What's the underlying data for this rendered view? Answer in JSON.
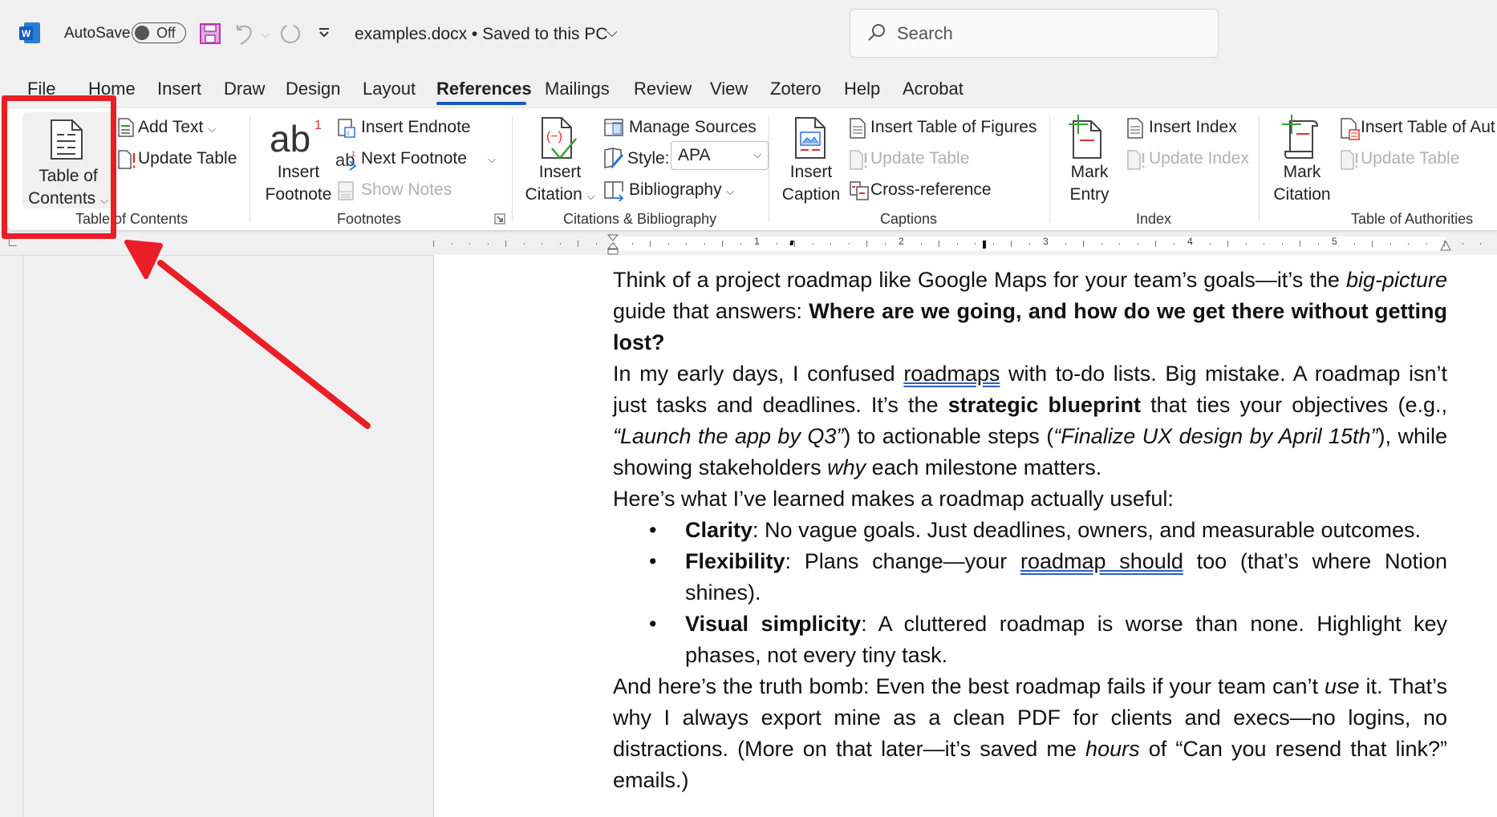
{
  "titlebar": {
    "app_icon": "word-icon",
    "autosave_label": "AutoSave",
    "autosave_state": "Off",
    "save_icon": "save-icon",
    "undo_icon": "undo-icon",
    "redo_icon": "redo-icon",
    "customize_icon": "customize-quick-access-icon",
    "document_title": "examples.docx • Saved to this PC",
    "search_placeholder": "Search"
  },
  "tabs": [
    {
      "label": "File"
    },
    {
      "label": "Home"
    },
    {
      "label": "Insert"
    },
    {
      "label": "Draw"
    },
    {
      "label": "Design"
    },
    {
      "label": "Layout"
    },
    {
      "label": "References",
      "active": true
    },
    {
      "label": "Mailings"
    },
    {
      "label": "Review"
    },
    {
      "label": "View"
    },
    {
      "label": "Zotero"
    },
    {
      "label": "Help"
    },
    {
      "label": "Acrobat"
    }
  ],
  "ribbon": {
    "toc": {
      "big_button": [
        "Table of",
        "Contents"
      ],
      "add_text": "Add Text",
      "update_table": "Update Table",
      "group_label": "Table of Contents"
    },
    "footnotes": {
      "big_button": [
        "Insert",
        "Footnote"
      ],
      "insert_endnote": "Insert Endnote",
      "next_footnote": "Next Footnote",
      "show_notes": "Show Notes",
      "group_label": "Footnotes"
    },
    "citations": {
      "big_button": [
        "Insert",
        "Citation"
      ],
      "manage_sources": "Manage Sources",
      "style_label": "Style:",
      "style_value": "APA",
      "bibliography": "Bibliography",
      "group_label": "Citations & Bibliography"
    },
    "captions": {
      "big_button": [
        "Insert",
        "Caption"
      ],
      "insert_table_of_figures": "Insert Table of Figures",
      "update_table": "Update Table",
      "cross_reference": "Cross-reference",
      "group_label": "Captions"
    },
    "index": {
      "big_button": [
        "Mark",
        "Entry"
      ],
      "insert_index": "Insert Index",
      "update_index": "Update Index",
      "group_label": "Index"
    },
    "authorities": {
      "big_button": [
        "Mark",
        "Citation"
      ],
      "insert_table": "Insert Table of Aut",
      "update_table": "Update Table",
      "group_label": "Table of Authorities"
    }
  },
  "ruler": {
    "numbers": [
      "1",
      "2",
      "3",
      "4",
      "5"
    ]
  },
  "document": {
    "p1": {
      "a": "Think of a project roadmap like Google Maps for your team’s goals—it’s the ",
      "b_italic": "big-picture",
      "c": " guide that answers: ",
      "d_bold": "Where are we going, and how do we get there without getting lost?"
    },
    "p2": {
      "a": "In my early days, I confused ",
      "b_underlined": "roadmaps",
      "c": " with to-do lists. Big mistake. A roadmap isn’t just tasks and deadlines. It’s the ",
      "d_bold": "strategic blueprint",
      "e": " that ties your objectives (e.g., ",
      "f_italic": "“Launch the app by Q3”",
      "g": ") to actionable steps (",
      "h_italic": "“Finalize UX design by April 15th”",
      "i": "), while showing stakeholders ",
      "j_italic": "why",
      "k": " each milestone matters."
    },
    "p3": "Here’s what I’ve learned makes a roadmap actually useful:",
    "bullets": [
      {
        "bold": "Clarity",
        "text": ": No vague goals. Just deadlines, owners, and measurable outcomes."
      },
      {
        "bold": "Flexibility",
        "text_a": ": Plans change—your ",
        "underlined": "roadmap should",
        "text_b": " too (that’s where Notion shines)."
      },
      {
        "bold": "Visual simplicity",
        "text": ": A cluttered roadmap is worse than none. Highlight key phases, not every tiny task."
      }
    ],
    "p4": {
      "a": "And here’s the truth bomb: Even the best roadmap fails if your team can’t ",
      "b_italic": "use",
      "c": " it. That’s why I always export mine as a clean PDF for clients and execs—no logins, no distractions. (More on that later—it’s saved me ",
      "d_italic": "hours",
      "e": " of “Can you resend that link?” emails.)"
    }
  },
  "annotation": {
    "highlight_color": "#e91e27",
    "target": "Table of Contents button"
  },
  "colors": {
    "accent": "#185abd",
    "annotation": "#e91e27",
    "save_icon": "#b43bb2"
  }
}
